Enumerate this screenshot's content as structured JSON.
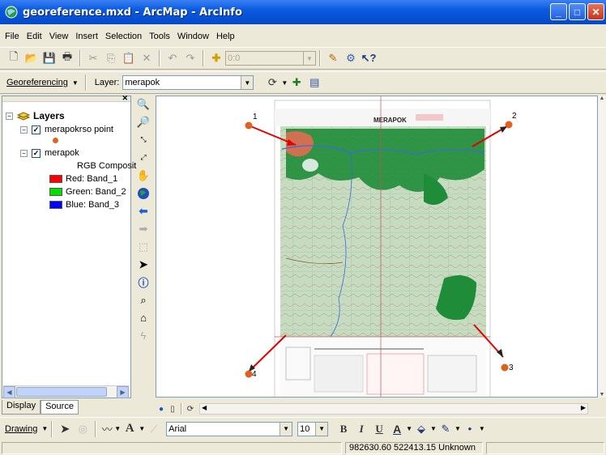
{
  "window": {
    "title": "georeference.mxd - ArcMap - ArcInfo",
    "buttons": {
      "minimize": "_",
      "maximize": "□",
      "close": "✕"
    }
  },
  "menu": [
    "File",
    "Edit",
    "View",
    "Insert",
    "Selection",
    "Tools",
    "Window",
    "Help"
  ],
  "standard_toolbar": {
    "scale_value": "0:0"
  },
  "georef_toolbar": {
    "menu_label": "Georeferencing",
    "layer_label": "Layer:",
    "layer_value": "merapok"
  },
  "toc": {
    "root": "Layers",
    "layers": [
      {
        "name": "merapokrso point",
        "checked": true
      },
      {
        "name": "merapok",
        "checked": true,
        "renderer": "RGB Composit"
      }
    ],
    "bands": [
      {
        "label": "Red:  Band_1",
        "color": "#ff0000"
      },
      {
        "label": "Green: Band_2",
        "color": "#00e000"
      },
      {
        "label": "Blue:  Band_3",
        "color": "#0000ff"
      }
    ],
    "tabs": [
      "Display",
      "Source"
    ]
  },
  "map": {
    "sheet_title": "MERAPOK",
    "control_points": [
      "1",
      "2",
      "3",
      "4"
    ],
    "point_color": "#e06020",
    "link_color": "#e00000"
  },
  "drawing_toolbar": {
    "drawing_label": "Drawing",
    "font_value": "Arial",
    "size_value": "10",
    "bold": "B",
    "italic": "I",
    "underline": "U",
    "text_tool": "A"
  },
  "status": {
    "coordinates": "982630.60  522413.15 Unknown"
  }
}
